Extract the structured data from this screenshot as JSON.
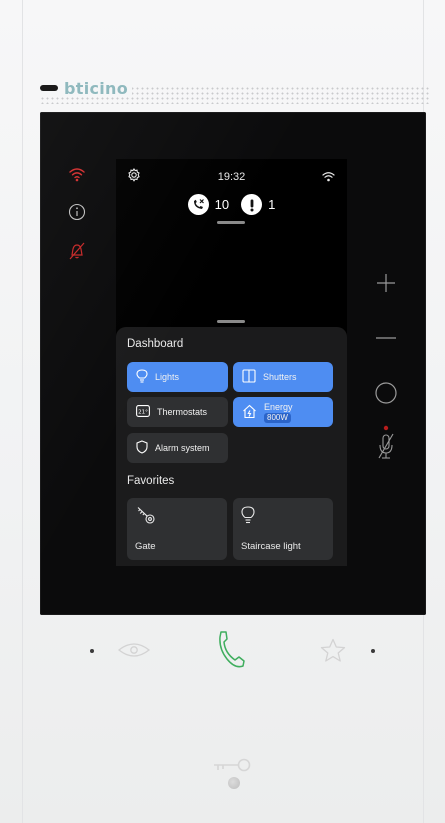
{
  "brand": {
    "logo_text": "bticino"
  },
  "status_bar": {
    "time": "19:32"
  },
  "badges": [
    {
      "icon": "missed-call-icon",
      "count": "10"
    },
    {
      "icon": "alert-icon",
      "count": "1"
    }
  ],
  "dashboard": {
    "title": "Dashboard",
    "tiles": [
      {
        "label": "Lights",
        "icon": "bulb-icon",
        "state": "active"
      },
      {
        "label": "Shutters",
        "icon": "shutter-icon",
        "state": "active"
      },
      {
        "label": "Thermostats",
        "icon": "thermostat-icon",
        "state": "inactive"
      },
      {
        "label": "Energy",
        "sublabel": "800W",
        "icon": "house-energy-icon",
        "state": "active"
      },
      {
        "label": "Alarm system",
        "icon": "shield-icon",
        "state": "inactive"
      }
    ]
  },
  "favorites": {
    "title": "Favorites",
    "items": [
      {
        "label": "Gate",
        "icon": "key-icon"
      },
      {
        "label": "Staircase light",
        "icon": "bulb-icon"
      }
    ]
  },
  "colors": {
    "accent": "#4e8df2",
    "tile_bg": "#2f3032",
    "sheet_bg": "#1b1b1c",
    "status_red": "#d32f2f",
    "call_green": "#3fae5e",
    "brand": "#8fb9be"
  },
  "hardware": {
    "left_indicators": [
      "wifi-icon",
      "info-icon",
      "mute-off-icon"
    ],
    "right_controls": [
      "plus-button",
      "minus-button",
      "circle-button",
      "mic-mute-button"
    ],
    "bottom_controls": [
      "eye-button",
      "answer-call-button",
      "star-button",
      "door-key-button"
    ]
  }
}
